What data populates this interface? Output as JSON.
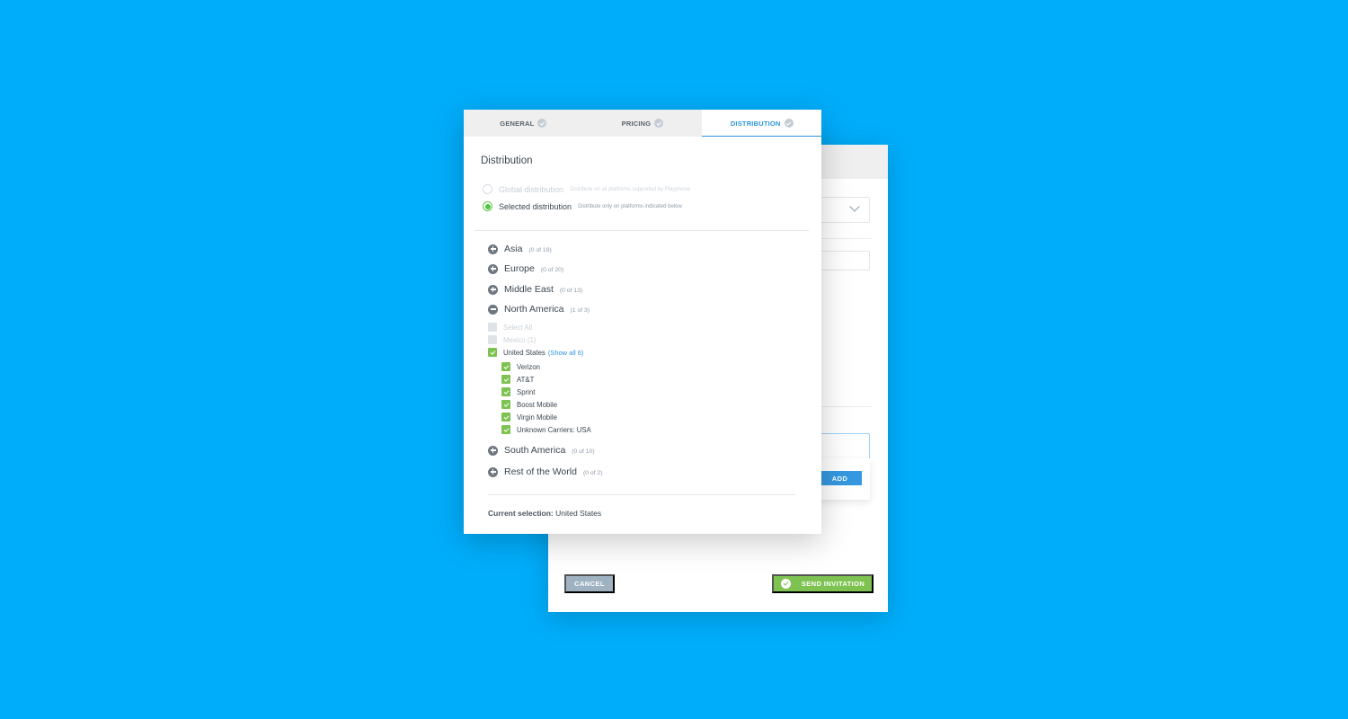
{
  "tabs": [
    {
      "label": "GENERAL",
      "active": false
    },
    {
      "label": "PRICING",
      "active": false
    },
    {
      "label": "DISTRIBUTION",
      "active": true
    }
  ],
  "section_title": "Distribution",
  "distribution_options": [
    {
      "label": "Global distribution",
      "description": "Distribute on all platforms supported by Playphone",
      "selected": false
    },
    {
      "label": "Selected distribution",
      "description": "Distribute only on platforms indicated below",
      "selected": true
    }
  ],
  "regions": {
    "asia": {
      "name": "Asia",
      "count": "(0 of 19)",
      "expanded": false
    },
    "europe": {
      "name": "Europe",
      "count": "(0 of 20)",
      "expanded": false
    },
    "middle_east": {
      "name": "Middle East",
      "count": "(0 of 13)",
      "expanded": false
    },
    "north_america": {
      "name": "North America",
      "count": "(1 of 3)",
      "expanded": true
    },
    "south_america": {
      "name": "South America",
      "count": "(0 of 10)",
      "expanded": false
    },
    "rest_of_world": {
      "name": "Rest of the World",
      "count": "(0 of 2)",
      "expanded": false
    }
  },
  "north_america": {
    "select_all": "Select All",
    "countries": [
      {
        "label": "Mexico (1)",
        "checked": false
      },
      {
        "label": "United States",
        "checked": true,
        "show_all": "(Show all 6)"
      }
    ],
    "carriers": [
      {
        "label": "Verizon",
        "checked": true
      },
      {
        "label": "AT&T",
        "checked": true
      },
      {
        "label": "Sprint",
        "checked": true
      },
      {
        "label": "Boost Mobile",
        "checked": true
      },
      {
        "label": "Virgin Mobile",
        "checked": true
      },
      {
        "label": "Unknown Carriers: USA",
        "checked": true
      }
    ]
  },
  "current_selection": {
    "label": "Current selection:",
    "value": "United States"
  },
  "back_panel": {
    "add_label": "ADD",
    "cancel_label": "CANCEL",
    "send_label": "SEND INVITATION"
  },
  "colors": {
    "background": "#00adfa",
    "accent_blue": "#2e95da",
    "success_green": "#7ec352",
    "cancel_gray": "#9fb2c2"
  }
}
